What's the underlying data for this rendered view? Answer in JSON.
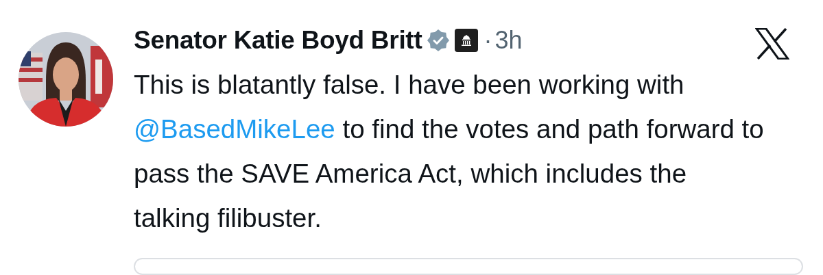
{
  "post": {
    "author": "Senator Katie Boyd Britt",
    "verified": true,
    "affiliation_badge": true,
    "separator": "·",
    "time": "3h",
    "body": [
      {
        "kind": "text",
        "text": "This is blatantly false. I have been working with "
      },
      {
        "kind": "mention",
        "text": "@BasedMikeLee"
      },
      {
        "kind": "text",
        "text": " to find the votes and path forward to pass the SAVE America Act, which includes the talking filibuster."
      }
    ],
    "quoted_card": {
      "kind": "card"
    }
  }
}
